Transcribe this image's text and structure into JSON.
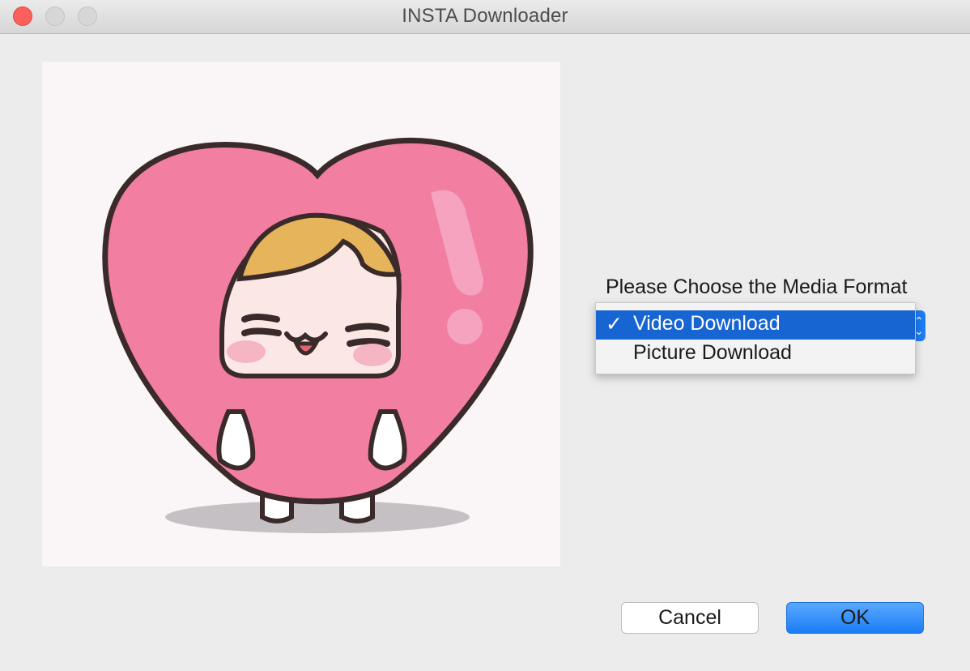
{
  "window": {
    "title": "INSTA Downloader"
  },
  "preview": {
    "image_icon": "heart-character-illustration"
  },
  "format": {
    "prompt": "Please Choose the Media Format",
    "options": [
      {
        "label": "Video Download",
        "checked": true
      },
      {
        "label": "Picture Download",
        "checked": false
      }
    ],
    "check_mark": "✓"
  },
  "buttons": {
    "cancel": "Cancel",
    "ok": "OK"
  },
  "colors": {
    "accent": "#1764d3",
    "heart": "#f27ea1",
    "close_button": "#fc605c"
  }
}
